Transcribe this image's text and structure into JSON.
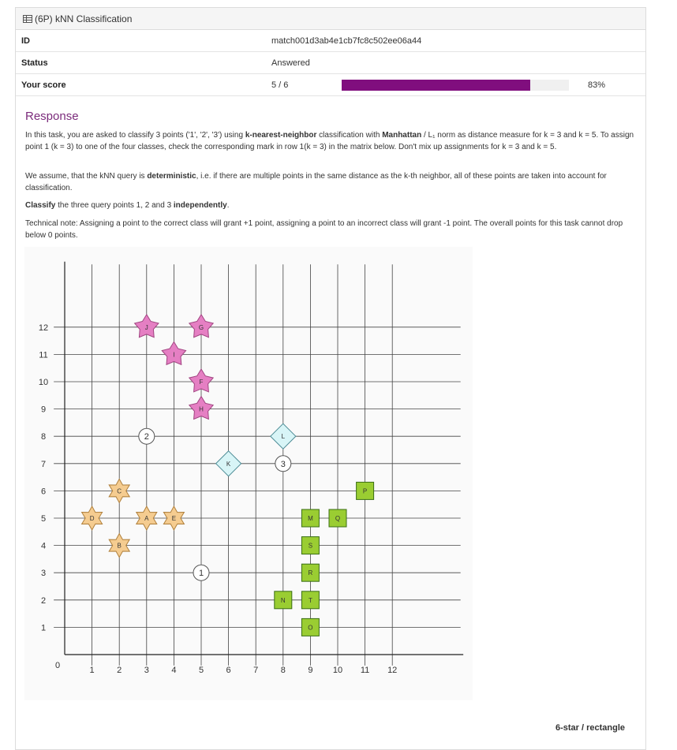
{
  "header": {
    "title": "(6P) kNN Classification",
    "icon": "table-icon"
  },
  "info": {
    "id_label": "ID",
    "id_value": "match001d3ab4e1cb7fc8c502ee06a44",
    "status_label": "Status",
    "status_value": "Answered",
    "score_label": "Your score",
    "score_value": "5 / 6",
    "score_fraction": 0.83,
    "score_percent": "83%",
    "bar_color": "#800e7e"
  },
  "response": {
    "title": "Response",
    "p1a": "In this task, you are asked to classify 3 points ('1', '2', '3') using ",
    "p1b": "k-nearest-neighbor",
    "p1c": " classification with ",
    "p1d": "Manhattan",
    "p1e": " / L₁ norm as distance measure for k = 3 and k = 5. To assign point 1 (k = 3) to one of the four classes, check the corresponding mark in row 1(k = 3) in the matrix below. Don't mix up assignments for k = 3 and k = 5.",
    "p2a": "We assume, that the kNN query is ",
    "p2b": "deterministic",
    "p2c": ", i.e. if there are multiple points in the same distance as the k-th neighbor, all of these points are taken into account for classification.",
    "p3a": "Classify",
    "p3b": " the three query points 1, 2 and 3 ",
    "p3c": "independently",
    "p3d": ".",
    "p4": "Technical note: Assigning a point to the correct class will grant +1 point, assigning a point to an incorrect class will grant -1 point. The overall points for this task cannot drop below 0 points."
  },
  "chart_data": {
    "type": "scatter",
    "xlim": [
      0,
      13
    ],
    "ylim": [
      0,
      13
    ],
    "x_ticks": [
      "1",
      "2",
      "3",
      "4",
      "5",
      "6",
      "7",
      "8",
      "9",
      "10",
      "11",
      "12"
    ],
    "y_ticks": [
      "1",
      "2",
      "3",
      "4",
      "5",
      "6",
      "7",
      "8",
      "9",
      "10",
      "11",
      "12"
    ],
    "origin_label": "0",
    "grid": true,
    "classes": {
      "star6": {
        "shape": "6-star",
        "color": "#f5cc90",
        "points": [
          {
            "label": "A",
            "x": 3,
            "y": 5
          },
          {
            "label": "B",
            "x": 2,
            "y": 4
          },
          {
            "label": "C",
            "x": 2,
            "y": 6
          },
          {
            "label": "D",
            "x": 1,
            "y": 5
          },
          {
            "label": "E",
            "x": 4,
            "y": 5
          }
        ]
      },
      "star5": {
        "shape": "5-star",
        "color": "#e57fc3",
        "points": [
          {
            "label": "F",
            "x": 5,
            "y": 10
          },
          {
            "label": "G",
            "x": 5,
            "y": 12
          },
          {
            "label": "H",
            "x": 5,
            "y": 9
          },
          {
            "label": "I",
            "x": 4,
            "y": 11
          },
          {
            "label": "J",
            "x": 3,
            "y": 12
          }
        ]
      },
      "diamond": {
        "shape": "diamond",
        "color": "#d8f5f7",
        "points": [
          {
            "label": "K",
            "x": 6,
            "y": 7
          },
          {
            "label": "L",
            "x": 8,
            "y": 8
          }
        ]
      },
      "rect": {
        "shape": "rectangle",
        "color": "#9acd32",
        "points": [
          {
            "label": "M",
            "x": 9,
            "y": 5
          },
          {
            "label": "N",
            "x": 8,
            "y": 2
          },
          {
            "label": "O",
            "x": 9,
            "y": 1
          },
          {
            "label": "P",
            "x": 11,
            "y": 6
          },
          {
            "label": "Q",
            "x": 10,
            "y": 5
          },
          {
            "label": "R",
            "x": 9,
            "y": 3
          },
          {
            "label": "S",
            "x": 9,
            "y": 4
          },
          {
            "label": "T",
            "x": 9,
            "y": 2
          }
        ]
      }
    },
    "queries": [
      {
        "label": "1",
        "x": 5,
        "y": 3
      },
      {
        "label": "2",
        "x": 3,
        "y": 8
      },
      {
        "label": "3",
        "x": 8,
        "y": 7
      }
    ]
  },
  "matrix_header": "6-star /     rectangle"
}
